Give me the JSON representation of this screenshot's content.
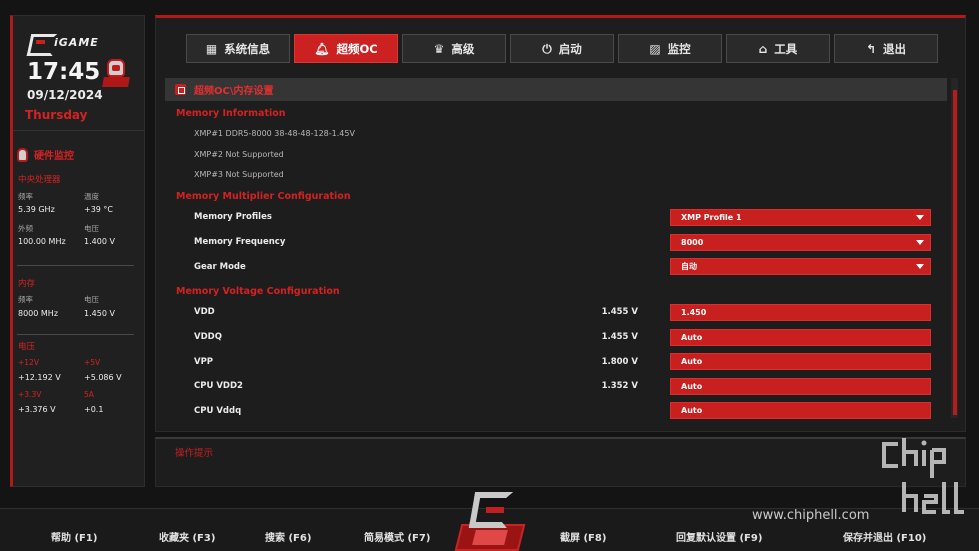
{
  "sidebar": {
    "brand": "iGAME",
    "time": "17:45",
    "date": "09/12/2024",
    "weekday": "Thursday",
    "monitor_title": "硬件监控",
    "cpu": {
      "title": "中央处理器",
      "freq_label": "频率",
      "freq_value": "5.39 GHz",
      "temp_label": "温度",
      "temp_value": "+39 °C",
      "bclk_label": "外频",
      "bclk_value": "100.00 MHz",
      "volt_label": "电压",
      "volt_value": "1.400 V"
    },
    "memory": {
      "title": "内存",
      "freq_label": "频率",
      "freq_value": "8000 MHz",
      "volt_label": "电压",
      "volt_value": "1.450 V"
    },
    "voltage": {
      "title": "电压",
      "v12_label": "+12V",
      "v12_value": "+12.192 V",
      "v5_label": "+5V",
      "v5_value": "+5.086 V",
      "v33_label": "+3.3V",
      "v33_value": "+3.376 V",
      "v5a_label": "5A",
      "v5a_value": "+0.1"
    }
  },
  "tabs": [
    {
      "label": "系统信息",
      "icon": "grid-icon",
      "glyph": "▦"
    },
    {
      "label": "超频OC",
      "icon": "bell-icon",
      "glyph": "🔔"
    },
    {
      "label": "高级",
      "icon": "crown-icon",
      "glyph": "♛"
    },
    {
      "label": "启动",
      "icon": "power-icon",
      "glyph": "⏻"
    },
    {
      "label": "监控",
      "icon": "monitor-icon",
      "glyph": "▨"
    },
    {
      "label": "工具",
      "icon": "toolbox-icon",
      "glyph": "⌂"
    },
    {
      "label": "退出",
      "icon": "back-arrow-icon",
      "glyph": "↰"
    }
  ],
  "active_tab": "超频OC",
  "breadcrumb": "超频OC\\内存设置",
  "memory_info": {
    "title": "Memory Information",
    "xmp1": "XMP#1 DDR5-8000 38-48-48-128-1.45V",
    "xmp2": "XMP#2 Not Supported",
    "xmp3": "XMP#3 Not Supported"
  },
  "multiplier": {
    "title": "Memory Multiplier Configuration",
    "profiles_label": "Memory Profiles",
    "profiles_value": "XMP Profile 1",
    "frequency_label": "Memory Frequency",
    "frequency_value": "8000",
    "gear_label": "Gear Mode",
    "gear_value": "自动"
  },
  "voltage_config": {
    "title": "Memory Voltage Configuration",
    "rows": [
      {
        "label": "VDD",
        "reading": "1.455 V",
        "value": "1.450"
      },
      {
        "label": "VDDQ",
        "reading": "1.455 V",
        "value": "Auto"
      },
      {
        "label": "VPP",
        "reading": "1.800 V",
        "value": "Auto"
      },
      {
        "label": "CPU VDD2",
        "reading": "1.352 V",
        "value": "Auto"
      },
      {
        "label": "CPU Vddq",
        "reading": "",
        "value": "Auto"
      }
    ]
  },
  "help": {
    "title": "操作提示"
  },
  "footer": {
    "help": "帮助 (F1)",
    "favorites": "收藏夹 (F3)",
    "search": "搜索 (F6)",
    "easy_mode": "简易模式 (F7)",
    "screenshot": "截屏 (F8)",
    "load_defaults": "回复默认设置 (F9)",
    "save_exit": "保存并退出 (F10)"
  },
  "watermark": {
    "url": "www.chiphell.com",
    "logo_text": "chip hell"
  },
  "colors": {
    "accent": "#cc2121",
    "panel": "#1d1d1d",
    "background": "#141414",
    "text": "#e6e6e6"
  }
}
